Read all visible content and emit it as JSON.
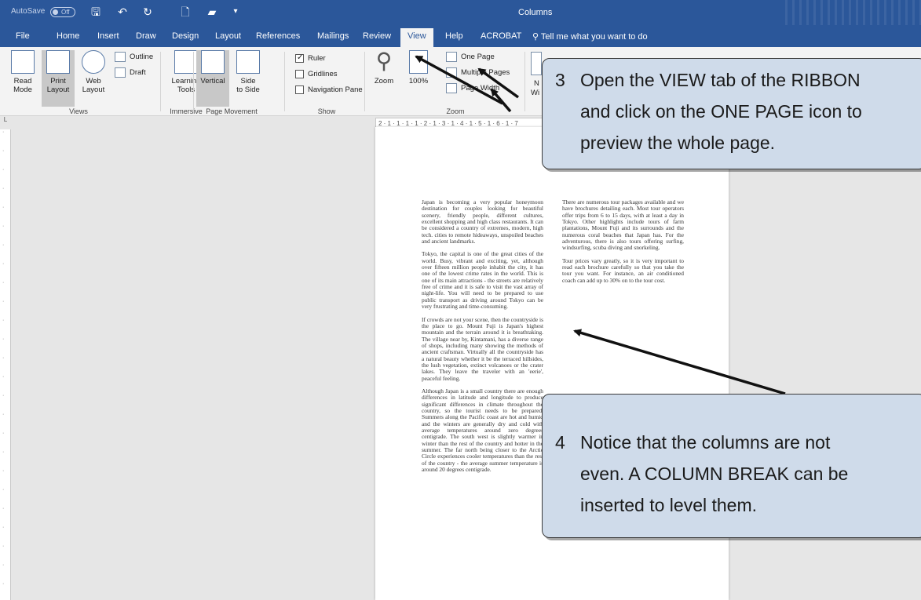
{
  "titlebar": {
    "autosave_label": "AutoSave",
    "autosave_state": "Off",
    "doc_title": "Columns"
  },
  "tabs": [
    "File",
    "Home",
    "Insert",
    "Draw",
    "Design",
    "Layout",
    "References",
    "Mailings",
    "Review",
    "View",
    "Help",
    "ACROBAT"
  ],
  "active_tab": "View",
  "tell_me": "Tell me what you want to do",
  "ribbon": {
    "views": {
      "read_mode": "Read\nMode",
      "print_layout": "Print\nLayout",
      "web_layout": "Web\nLayout",
      "outline": "Outline",
      "draft": "Draft",
      "label": "Views"
    },
    "immersive": {
      "learning_tools": "Learning\nTools",
      "label": "Immersive"
    },
    "page_movement": {
      "vertical": "Vertical",
      "side_to_side": "Side\nto Side",
      "label": "Page Movement"
    },
    "show": {
      "ruler": "Ruler",
      "gridlines": "Gridlines",
      "navigation_pane": "Navigation Pane",
      "label": "Show"
    },
    "zoom": {
      "zoom": "Zoom",
      "hundred": "100%",
      "one_page": "One Page",
      "multiple_pages": "Multiple Pages",
      "page_width": "Page Width",
      "label": "Zoom"
    },
    "partial_a": "N",
    "partial_b": "Wi"
  },
  "ruler_top_text": "2 · 1 · 1 · 1 · 1 · 2 · 1 · 3 · 1 · 4 · 1 · 5 · 1 · 6 · 1 · 7",
  "document": {
    "col1": [
      "Japan is becoming a very popular honeymoon destination for couples looking for beautiful scenery, friendly people, different cultures, excellent shopping and high class restaurants. It can be considered a country of extremes, modern, high tech. cities to remote hideaways, unspoiled beaches and ancient landmarks.",
      "Tokyo, the capital is one of the great cities of the world. Busy, vibrant and exciting, yet, although over fifteen million people inhabit the city, it has one of the lowest crime rates in the world. This is one of its main attractions - the streets are relatively free of crime and it is safe to visit the vast array of night-life. You will need to be prepared to use public transport as driving around Tokyo can be very frustrating and time-consuming.",
      "If crowds are not your scene, then the countryside is the place to go. Mount Fuji is Japan's highest mountain and the terrain around it is breathtaking. The village near by, Kintamani, has a diverse range of shops, including many showing the methods of ancient craftsman. Virtually all the countryside has a natural beauty whether it be the terraced hillsides, the lush vegetation, extinct volcanoes or the crater lakes. They leave the traveler with an 'eerie', peaceful feeling.",
      "Although Japan is a small country there are enough differences in latitude and longitude to produce significant differences in climate throughout the country, so the tourist needs to be prepared. Summers along the Pacific coast are hot and humid and the winters are generally dry and cold with average temperatures around zero degrees centigrade. The south west is slightly warmer in winter than the rest of the country and hotter in the summer. The far north being closer to the Arctic Circle experiences cooler temperatures than the rest of the country - the average summer temperature is around 20 degrees centigrade."
    ],
    "col2": [
      "There are numerous tour packages available and we have brochures detailing each. Most tour operators offer trips from 6 to 15 days, with at least a day in Tokyo. Other highlights include tours of farm plantations, Mount Fuji and its surrounds and the numerous coral beaches that Japan has. For the adventurous, there is also tours offering surfing, windsurfing, scuba diving and snorkeling.",
      "Tour prices vary greatly, so it is very important to read each brochure carefully so that you take the tour you want. For instance, an air conditioned coach can add up to 30% on to the tour cost."
    ]
  },
  "callouts": {
    "step3": {
      "num": "3",
      "lines": [
        "Open the VIEW tab of the RIBBON",
        "and click on the ONE PAGE icon to",
        "preview the whole page."
      ]
    },
    "step4": {
      "num": "4",
      "lines": [
        "Notice that the columns are not",
        "even.  A COLUMN BREAK can be",
        "inserted to level them."
      ]
    }
  }
}
